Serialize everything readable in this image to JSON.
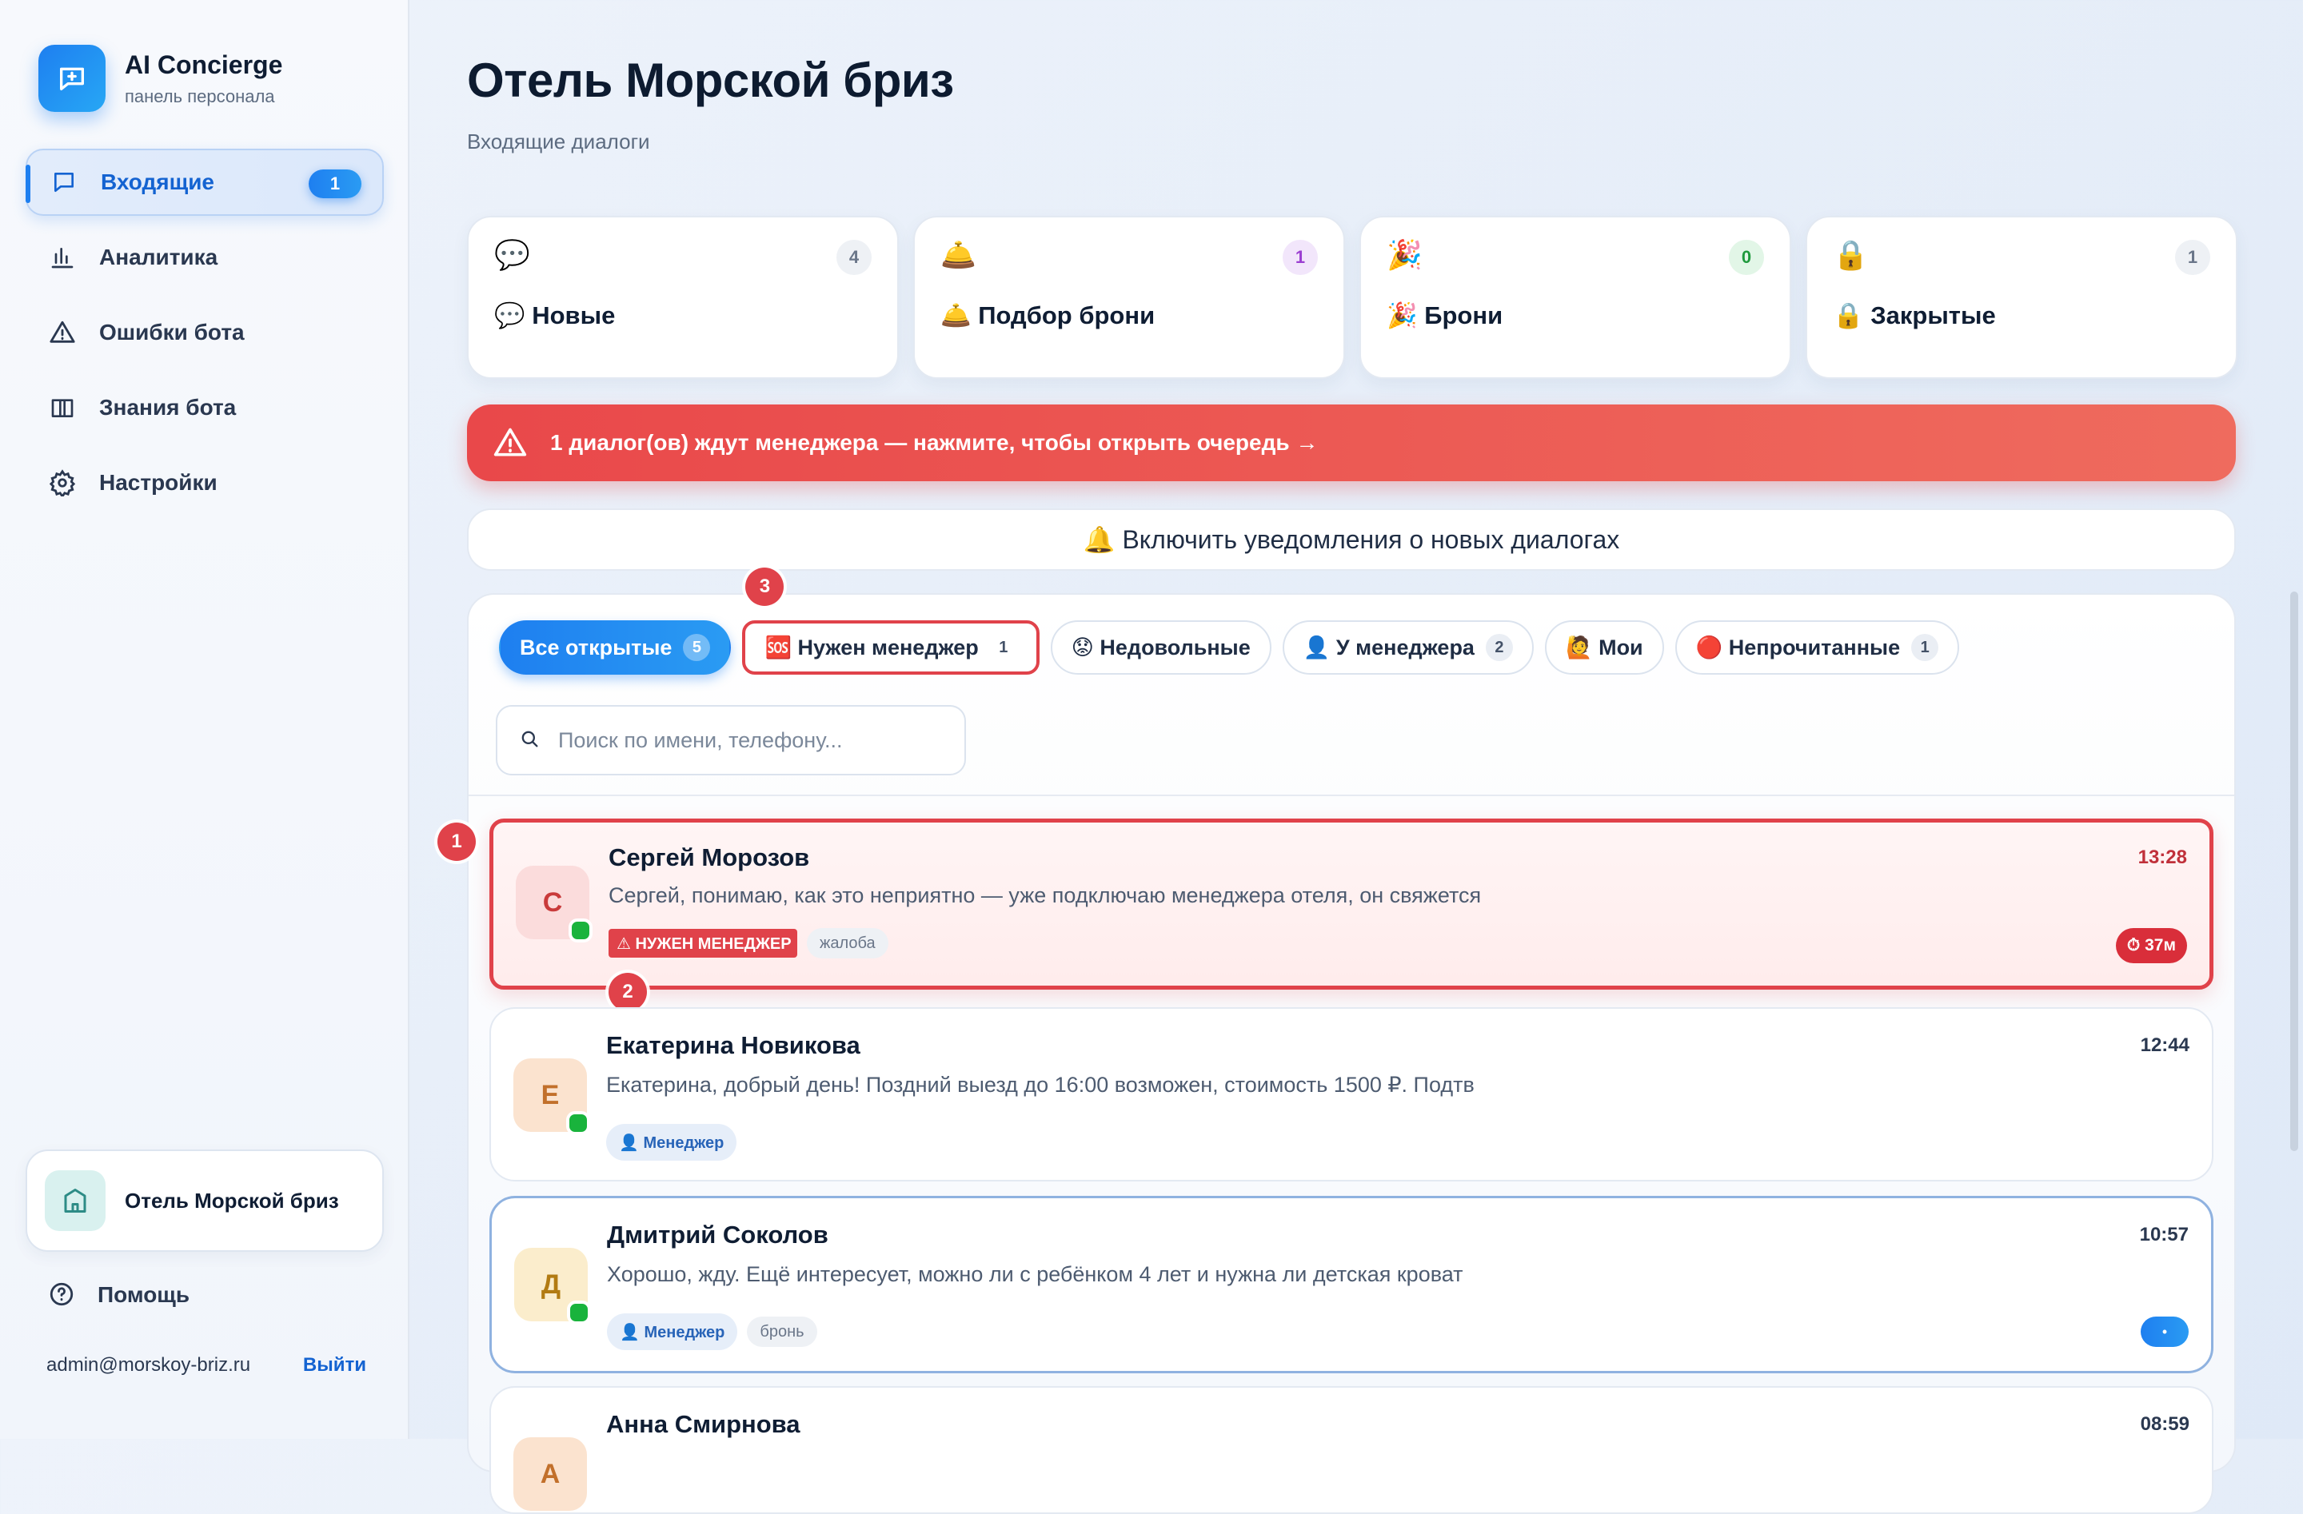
{
  "brand": {
    "title": "AI Concierge",
    "subtitle": "панель персонала"
  },
  "sidebar": {
    "items": [
      {
        "label": "Входящие",
        "icon": "chat-icon",
        "badge": "1",
        "active": true
      },
      {
        "label": "Аналитика",
        "icon": "bar-chart-icon"
      },
      {
        "label": "Ошибки бота",
        "icon": "warning-icon"
      },
      {
        "label": "Знания бота",
        "icon": "book-icon"
      },
      {
        "label": "Настройки",
        "icon": "gear-icon"
      }
    ],
    "hotel_name": "Отель Морской бриз",
    "help_label": "Помощь",
    "user_email": "admin@morskoy-briz.ru",
    "logout_label": "Выйти"
  },
  "header": {
    "title": "Отель Морской бриз",
    "subtitle": "Входящие диалоги"
  },
  "stats": [
    {
      "emoji": "💬",
      "label": "💬 Новые",
      "count": "4",
      "count_bg": "#eef1f5",
      "count_color": "#6a7689"
    },
    {
      "emoji": "🛎️",
      "label": "🛎️ Подбор брони",
      "count": "1",
      "count_bg": "#f2e6fb",
      "count_color": "#9b3fd1"
    },
    {
      "emoji": "🎉",
      "label": "🎉 Брони",
      "count": "0",
      "count_bg": "#e2f6e7",
      "count_color": "#1f9a3d"
    },
    {
      "emoji": "🔒",
      "label": "🔒 Закрытые",
      "count": "1",
      "count_bg": "#eef1f5",
      "count_color": "#6a7689"
    }
  ],
  "alert": {
    "text": "1 диалог(ов) ждут менеджера — нажмите, чтобы открыть очередь →"
  },
  "notify": {
    "text": "🔔 Включить уведомления о новых диалогах"
  },
  "filters": [
    {
      "label": "Все открытые",
      "count": "5",
      "style": "primary"
    },
    {
      "label": "🆘 Нужен менеджер",
      "count": "1",
      "style": "outlined"
    },
    {
      "label": "😟 Недовольные",
      "count": ""
    },
    {
      "label": "👤 У менеджера",
      "count": "2"
    },
    {
      "label": "🙋 Мои",
      "count": ""
    },
    {
      "label": "🔴 Непрочитанные",
      "count": "1"
    }
  ],
  "markers": [
    "1",
    "2",
    "3"
  ],
  "search": {
    "placeholder": "Поиск по имени, телефону..."
  },
  "conversations": [
    {
      "initial": "С",
      "name": "Сергей Морозов",
      "time": "13:28",
      "message": "Сергей, понимаю, как это неприятно — уже подключаю менеджера отеля, он свяжется",
      "tags": [
        "⚠ НУЖЕН МЕНЕДЖЕР",
        "жалоба"
      ],
      "timer": "⏱ 37м",
      "avatar_bg": "#fbdcdc",
      "avatar_color": "#c93b3b"
    },
    {
      "initial": "Е",
      "name": "Екатерина Новикова",
      "time": "12:44",
      "message": "Екатерина, добрый день! Поздний выезд до 16:00 возможен, стоимость 1500 ₽. Подтв",
      "tags": [
        "👤 Менеджер"
      ],
      "avatar_bg": "#fbe3cf",
      "avatar_color": "#c2702b"
    },
    {
      "initial": "Д",
      "name": "Дмитрий Соколов",
      "time": "10:57",
      "message": "Хорошо, жду. Ещё интересует, можно ли с ребёнком 4 лет и нужна ли детская кроват",
      "tags": [
        "👤 Менеджер",
        "бронь"
      ],
      "unread_dot": "•",
      "avatar_bg": "#fbedcc",
      "avatar_color": "#b27b12"
    },
    {
      "initial": "А",
      "name": "Анна Смирнова",
      "time": "08:59",
      "avatar_bg": "#fbe3cf",
      "avatar_color": "#c2702b"
    }
  ]
}
